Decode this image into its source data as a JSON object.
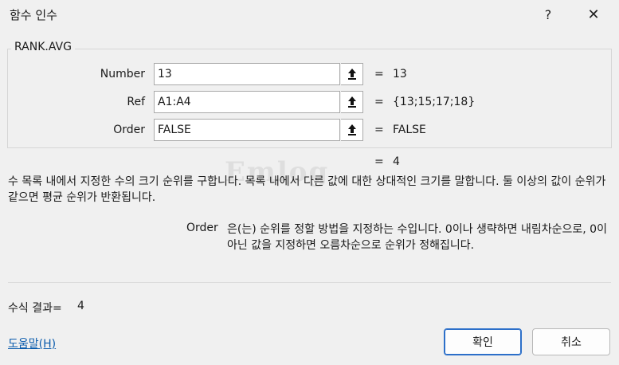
{
  "window": {
    "title": "함수 인수",
    "help_button": "?",
    "close_button": "✕"
  },
  "function": {
    "name": "RANK.AVG"
  },
  "arguments": [
    {
      "label": "Number",
      "value": "13",
      "result": "13"
    },
    {
      "label": "Ref",
      "value": "A1:A4",
      "result": "{13;15;17;18}"
    },
    {
      "label": "Order",
      "value": "FALSE",
      "result": "FALSE"
    }
  ],
  "equals_sign": "=",
  "function_result": "4",
  "description": "수 목록 내에서 지정한 수의 크기 순위를 구합니다. 목록 내에서 다른 값에 대한 상대적인 크기를 말합니다. 둘 이상의 값이 순위가 같으면 평균 순위가 반환됩니다.",
  "argument_help": {
    "name": "Order",
    "text": "은(는) 순위를 정할 방법을 지정하는 수입니다. 0이나 생략하면 내림차순으로, 0이 아닌 값을 지정하면 오름차순으로 순위가 정해집니다."
  },
  "formula_result": {
    "label": "수식 결과=",
    "value": "4"
  },
  "help_link": "도움말(H)",
  "buttons": {
    "ok": "확인",
    "cancel": "취소"
  },
  "watermark": "Emlog"
}
